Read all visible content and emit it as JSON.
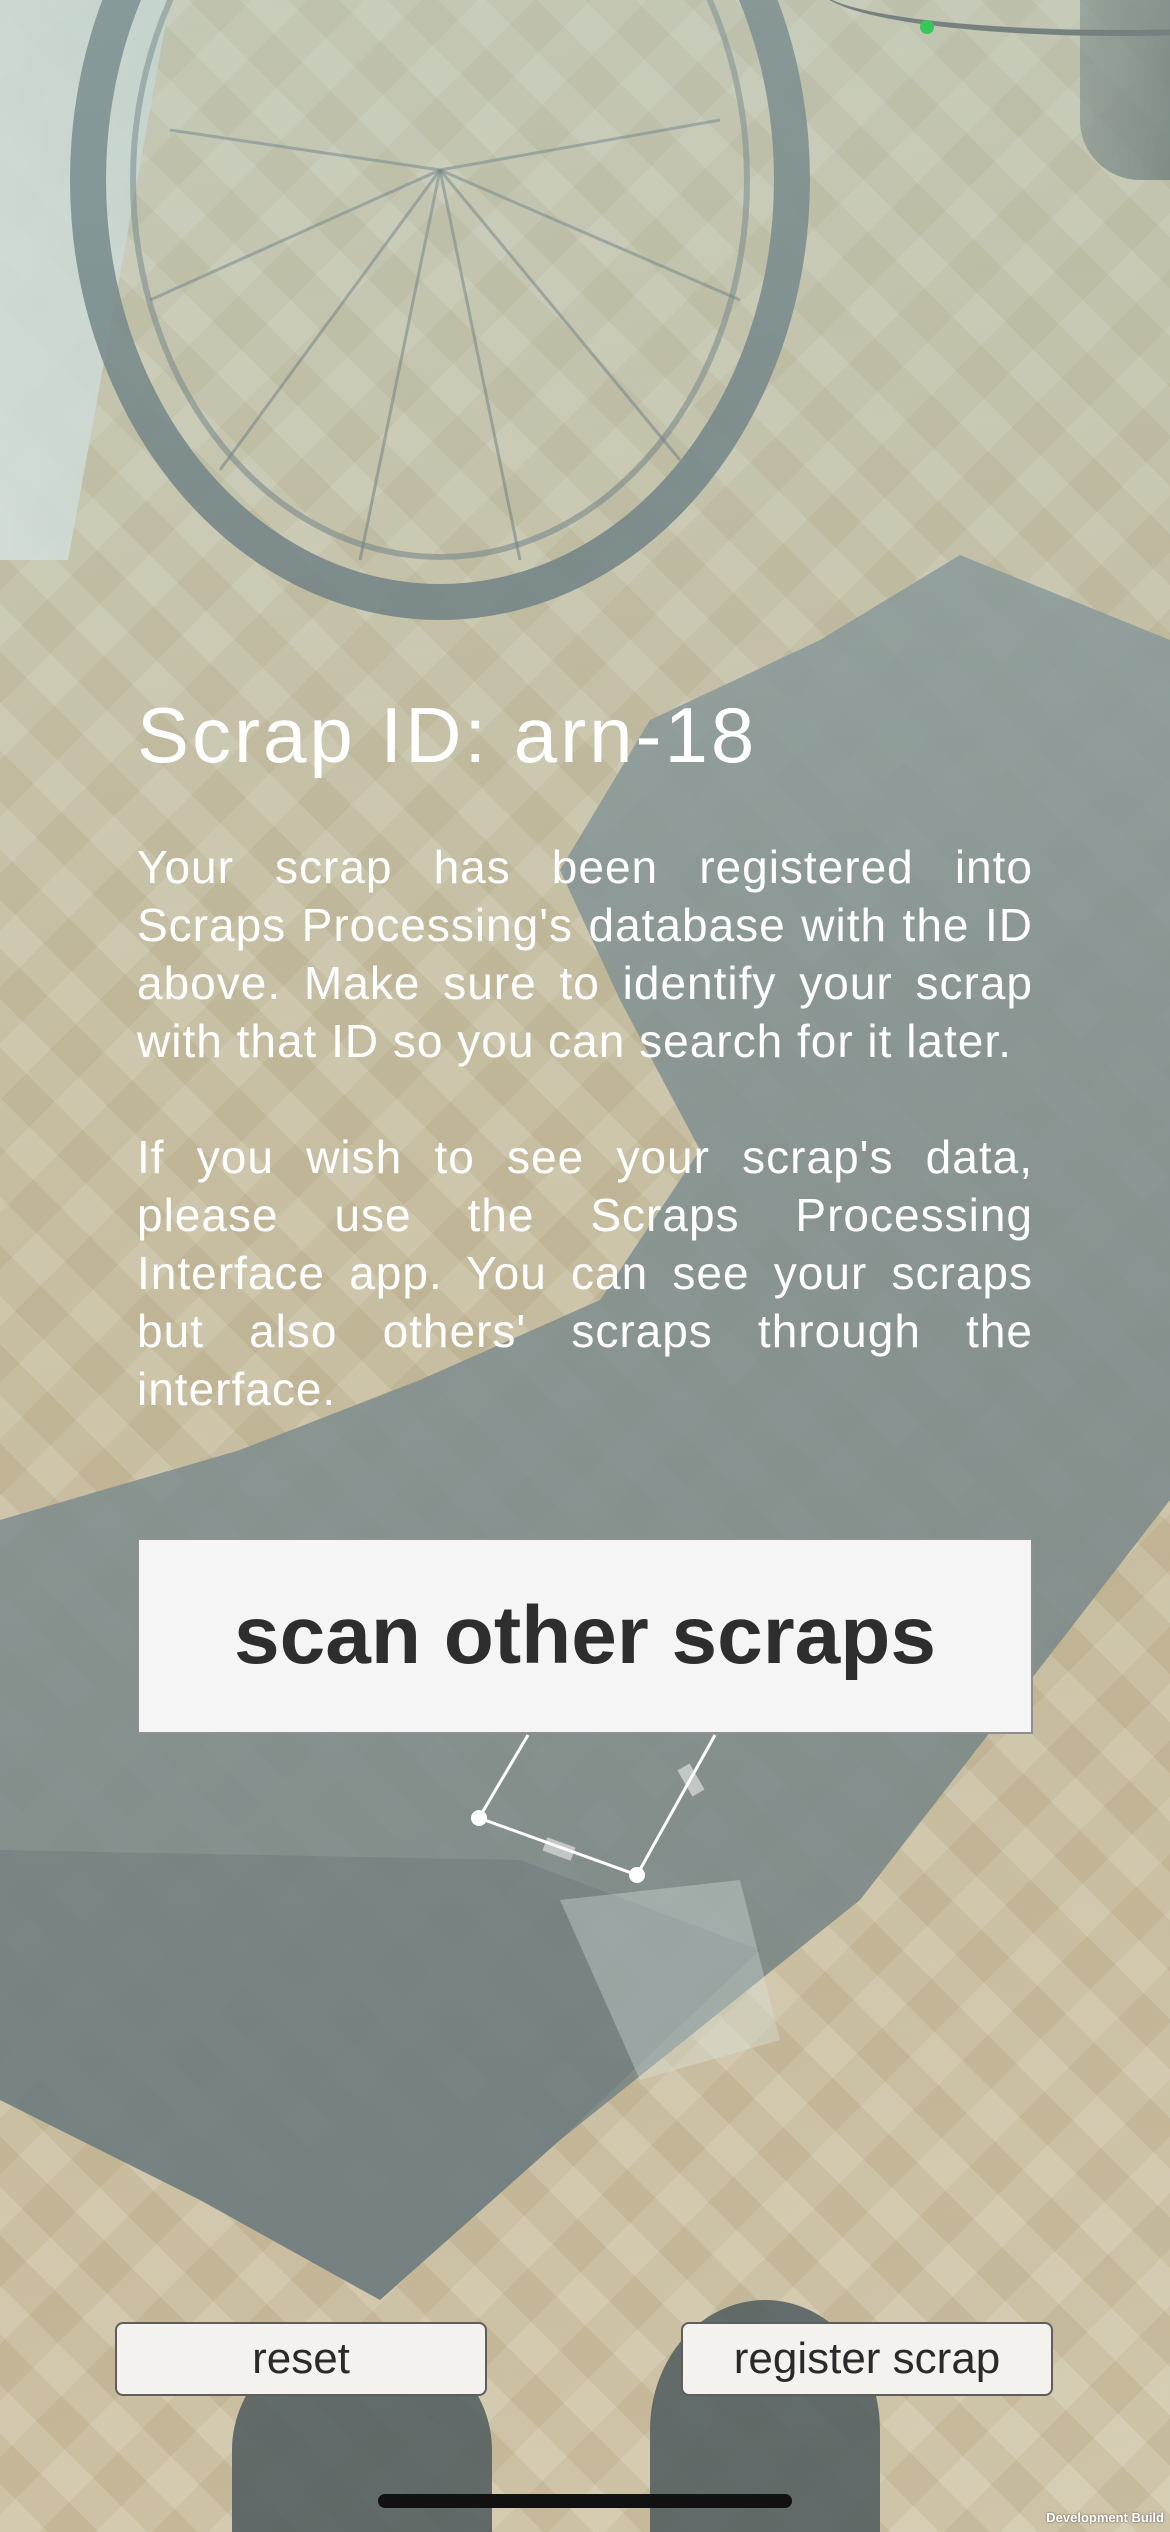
{
  "scrap_panel": {
    "title": "Scrap ID: arn-18",
    "paragraph_1": "Your scrap has been registered into Scraps Processing's database with the ID above. Make sure to identify your scrap with that ID so you can search for it later.",
    "paragraph_2": "If you wish to see your scrap's data, please use the Scraps Processing Interface app. You can see your scraps but also others' scraps through the interface."
  },
  "buttons": {
    "scan_other": "scan other scraps",
    "reset": "reset",
    "register": "register scrap"
  },
  "footer": {
    "build_label": "Development Build"
  },
  "colors": {
    "status_dot": "#35c759",
    "button_bg": "#f5f5f5",
    "text_on_camera": "#ffffff"
  }
}
